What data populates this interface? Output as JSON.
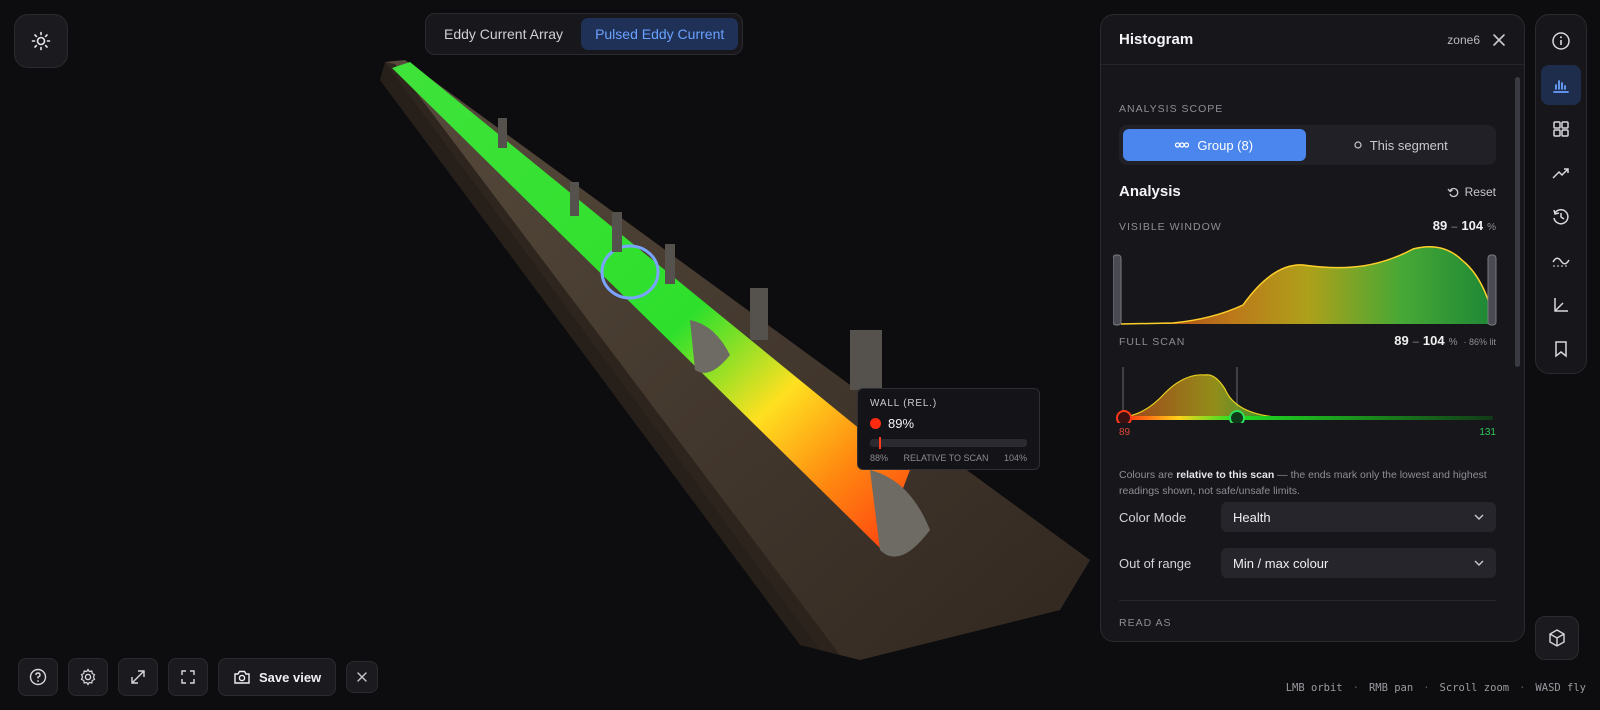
{
  "mode_toggle": {
    "options": [
      "Eddy Current Array",
      "Pulsed Eddy Current"
    ],
    "active": "Pulsed Eddy Current"
  },
  "tooltip": {
    "title": "WALL (REL.)",
    "value": "89%",
    "min_label": "88%",
    "mid_label": "RELATIVE TO SCAN",
    "max_label": "104%",
    "position_fraction": 0.06
  },
  "panel": {
    "title": "Histogram",
    "zone": "zone6",
    "scope_label": "ANALYSIS SCOPE",
    "scope_options": [
      "Group (8)",
      "This segment"
    ],
    "scope_active": "Group (8)",
    "analysis_title": "Analysis",
    "reset_label": "Reset",
    "visible_window": {
      "label": "VISIBLE WINDOW",
      "min": "89",
      "max": "104",
      "unit": "%"
    },
    "full_scan": {
      "label": "FULL SCAN",
      "min": "89",
      "max": "104",
      "unit": "%",
      "lit": "· 86% lit",
      "axis_min": "89",
      "axis_max": "131"
    },
    "note_pre": "Colours are ",
    "note_bold": "relative to this scan",
    "note_post": " — the ends mark only the lowest and highest readings shown, not safe/unsafe limits.",
    "color_mode": {
      "label": "Color Mode",
      "value": "Health"
    },
    "out_of_range": {
      "label": "Out of range",
      "value": "Min / max colour"
    },
    "read_as_label": "READ AS"
  },
  "bottom": {
    "save_label": "Save view"
  },
  "hints": [
    "LMB orbit",
    "RMB pan",
    "Scroll zoom",
    "WASD fly"
  ],
  "colors": {
    "accent": "#4a86ee",
    "good": "#22c55e",
    "bad": "#ff2a10",
    "mid": "#f5c518"
  },
  "icons": {
    "theme": "sun-icon",
    "close": "close-icon",
    "info": "info-icon",
    "histogram": "bar-chart-icon",
    "grid": "grid-icon",
    "trend": "trend-icon",
    "history": "history-icon",
    "profile": "profile-icon",
    "axes": "axes-icon",
    "bookmark": "bookmark-icon",
    "cube": "cube-icon",
    "help": "help-icon",
    "settings": "gear-icon",
    "expand": "expand-icon",
    "fullscreen": "fullscreen-icon",
    "camera": "camera-icon"
  }
}
